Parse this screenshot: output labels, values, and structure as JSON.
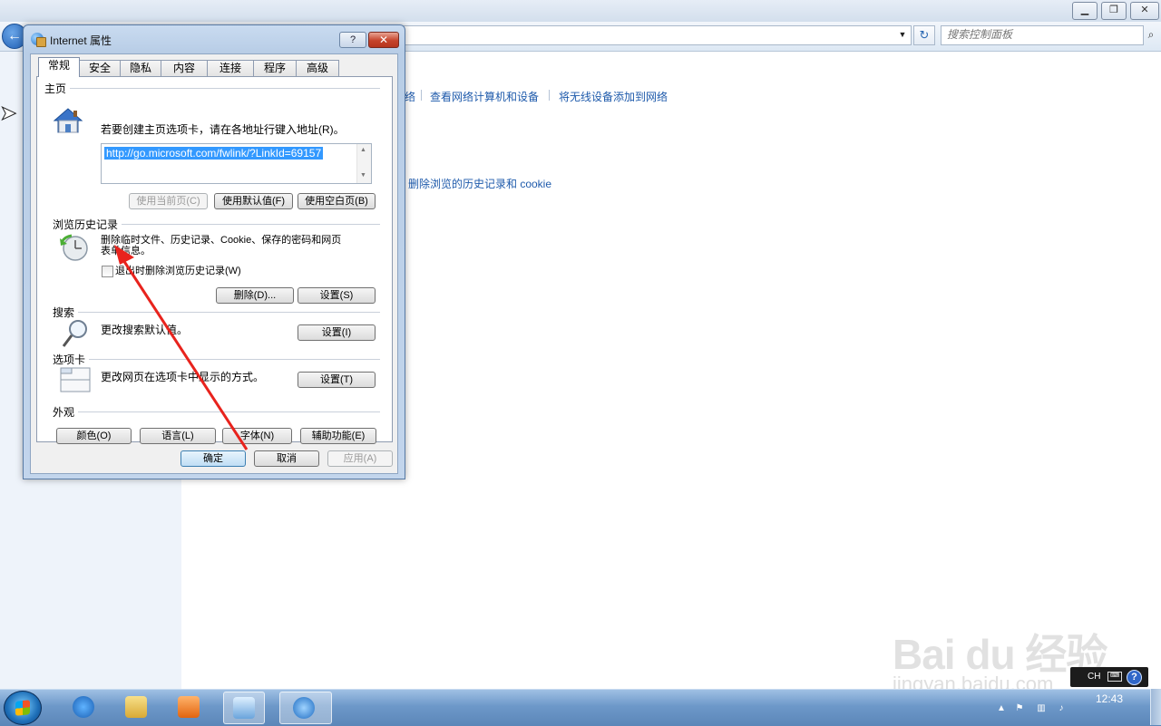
{
  "window": {
    "search_placeholder": "搜索控制面板",
    "minimize_icon": "minimize-icon",
    "maximize_icon": "restore-icon",
    "close_icon": "close-icon"
  },
  "control_panel": {
    "links_row1": [
      "查看网络计算机和设备",
      "将无线设备添加到网络"
    ],
    "partial_link_char": "络",
    "link_row2": "删除浏览的历史记录和 cookie"
  },
  "dialog": {
    "title": "Internet 属性",
    "help_label": "?",
    "close_label": "✕",
    "tabs": [
      "常规",
      "安全",
      "隐私",
      "内容",
      "连接",
      "程序",
      "高级"
    ],
    "active_tab": 0,
    "homepage": {
      "section_title": "主页",
      "description": "若要创建主页选项卡，请在各地址行键入地址(R)。",
      "url": "http://go.microsoft.com/fwlink/?LinkId=69157",
      "btn_use_current": "使用当前页(C)",
      "btn_use_default": "使用默认值(F)",
      "btn_use_blank": "使用空白页(B)"
    },
    "history": {
      "section_title": "浏览历史记录",
      "description_line1": "删除临时文件、历史记录、Cookie、保存的密码和网页",
      "description_line2": "表单信息。",
      "checkbox_label": "退出时删除浏览历史记录(W)",
      "checkbox_checked": false,
      "btn_delete": "删除(D)...",
      "btn_settings": "设置(S)"
    },
    "search": {
      "section_title": "搜索",
      "description": "更改搜索默认值。",
      "btn_settings": "设置(I)"
    },
    "tabs_section": {
      "section_title": "选项卡",
      "description": "更改网页在选项卡中显示的方式。",
      "btn_settings": "设置(T)"
    },
    "appearance": {
      "section_title": "外观",
      "btn_colors": "颜色(O)",
      "btn_languages": "语言(L)",
      "btn_fonts": "字体(N)",
      "btn_accessibility": "辅助功能(E)"
    },
    "footer": {
      "btn_ok": "确定",
      "btn_cancel": "取消",
      "btn_apply": "应用(A)"
    }
  },
  "annotation": {
    "color": "#e8231d"
  },
  "watermark": {
    "logo": "Bai du 经验",
    "url": "jingyan.baidu.com"
  },
  "taskbar": {
    "ime": "CH",
    "help": "?",
    "clock": "12:43",
    "pinned": [
      "start-button",
      "internet-explorer-icon",
      "file-explorer-icon",
      "media-player-icon",
      "control-panel-icon",
      "internet-properties-icon"
    ]
  }
}
